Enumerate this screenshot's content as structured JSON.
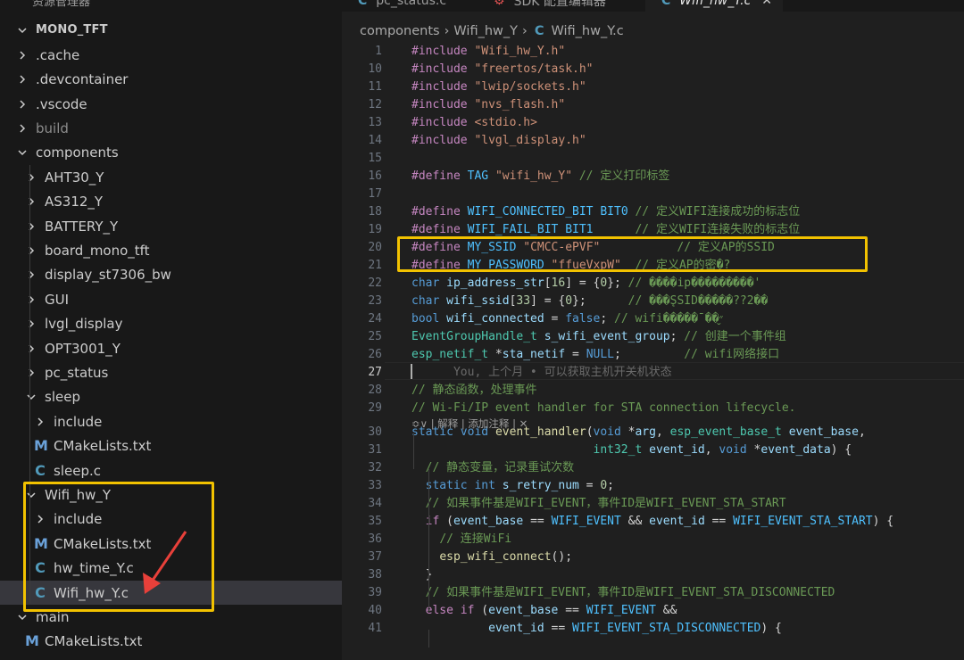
{
  "explorer": {
    "title": "资源管理器",
    "root": "MONO_TFT",
    "items": [
      {
        "label": ".cache",
        "icon": "chevron-right-icon"
      },
      {
        "label": ".devcontainer",
        "icon": "chevron-right-icon"
      },
      {
        "label": ".vscode",
        "icon": "chevron-right-icon"
      },
      {
        "label": "build",
        "icon": "chevron-right-icon"
      },
      {
        "label": "components",
        "icon": "chevron-down-icon"
      },
      {
        "label": "AHT30_Y",
        "icon": "chevron-right-icon"
      },
      {
        "label": "AS312_Y",
        "icon": "chevron-right-icon"
      },
      {
        "label": "BATTERY_Y",
        "icon": "chevron-right-icon"
      },
      {
        "label": "board_mono_tft",
        "icon": "chevron-right-icon"
      },
      {
        "label": "display_st7306_bw",
        "icon": "chevron-right-icon"
      },
      {
        "label": "GUI",
        "icon": "chevron-right-icon"
      },
      {
        "label": "lvgl_display",
        "icon": "chevron-right-icon"
      },
      {
        "label": "OPT3001_Y",
        "icon": "chevron-right-icon"
      },
      {
        "label": "pc_status",
        "icon": "chevron-right-icon"
      },
      {
        "label": "sleep",
        "icon": "chevron-down-icon"
      },
      {
        "label": "include",
        "icon": "chevron-right-icon"
      },
      {
        "label": "CMakeLists.txt",
        "icon": "cmake-file-icon",
        "glyph": "M"
      },
      {
        "label": "sleep.c",
        "icon": "c-file-icon",
        "glyph": "C"
      },
      {
        "label": "Wifi_hw_Y",
        "icon": "chevron-down-icon"
      },
      {
        "label": "include",
        "icon": "chevron-right-icon"
      },
      {
        "label": "CMakeLists.txt",
        "icon": "cmake-file-icon",
        "glyph": "M"
      },
      {
        "label": "hw_time_Y.c",
        "icon": "c-file-icon",
        "glyph": "C"
      },
      {
        "label": "Wifi_hw_Y.c",
        "icon": "c-file-icon",
        "glyph": "C"
      },
      {
        "label": "main",
        "icon": "chevron-down-icon"
      },
      {
        "label": "CMakeLists.txt",
        "icon": "cmake-file-icon",
        "glyph": "M"
      }
    ]
  },
  "tabs": [
    {
      "label": "pc_status.c",
      "glyph": "C",
      "active": false
    },
    {
      "label": "SDK 配置编辑器",
      "glyph": "⚙",
      "active": false
    },
    {
      "label": "Wifi_hw_Y.c",
      "glyph": "C",
      "active": true,
      "close": "✕"
    }
  ],
  "breadcrumb": {
    "part1": "components",
    "sep": "›",
    "part2": "Wifi_hw_Y",
    "file_glyph": "C",
    "part3": "Wifi_hw_Y.c"
  },
  "codelens": "≎∨ | 解释 | 添加注释 | ✕",
  "code_lines": [
    {
      "n": "1",
      "t": [
        [
          "pp",
          "#include "
        ],
        [
          "str",
          "\"Wifi_hw_Y.h\""
        ]
      ]
    },
    {
      "n": "10",
      "t": [
        [
          "pp",
          "#include "
        ],
        [
          "str",
          "\"freertos/task.h\""
        ]
      ]
    },
    {
      "n": "11",
      "t": [
        [
          "pp",
          "#include "
        ],
        [
          "str",
          "\"lwip/sockets.h\""
        ]
      ]
    },
    {
      "n": "12",
      "t": [
        [
          "pp",
          "#include "
        ],
        [
          "str",
          "\"nvs_flash.h\""
        ]
      ]
    },
    {
      "n": "13",
      "t": [
        [
          "pp",
          "#include "
        ],
        [
          "str",
          "<stdio.h>"
        ]
      ]
    },
    {
      "n": "14",
      "t": [
        [
          "pp",
          "#include "
        ],
        [
          "str",
          "\"lvgl_display.h\""
        ]
      ]
    },
    {
      "n": "15",
      "t": []
    },
    {
      "n": "16",
      "t": [
        [
          "pp",
          "#define "
        ],
        [
          "mac",
          "TAG "
        ],
        [
          "str",
          "\"wifi_hw_Y\""
        ],
        [
          "cm",
          " // 定义打印标签"
        ]
      ]
    },
    {
      "n": "17",
      "t": []
    },
    {
      "n": "18",
      "t": [
        [
          "pp",
          "#define "
        ],
        [
          "mac",
          "WIFI_CONNECTED_BIT "
        ],
        [
          "mac",
          "BIT0"
        ],
        [
          "cm",
          " // 定义WIFI连接成功的标志位"
        ]
      ]
    },
    {
      "n": "19",
      "t": [
        [
          "pp",
          "#define "
        ],
        [
          "mac",
          "WIFI_FAIL_BIT "
        ],
        [
          "mac",
          "BIT1"
        ],
        [
          "cm",
          "      // 定义WIFI连接失败的标志位"
        ]
      ]
    },
    {
      "n": "20",
      "t": [
        [
          "pp",
          "#define "
        ],
        [
          "mac",
          "MY_SSID "
        ],
        [
          "str",
          "\"CMCC-ePVF\""
        ],
        [
          "cm",
          "           // 定义AP的SSID"
        ]
      ]
    },
    {
      "n": "21",
      "t": [
        [
          "pp",
          "#define "
        ],
        [
          "mac",
          "MY_PASSWORD "
        ],
        [
          "str",
          "\"ffueVxpW\""
        ],
        [
          "cm",
          "  // 定义AP的密�?"
        ]
      ]
    },
    {
      "n": "22",
      "t": [
        [
          "kw",
          "char "
        ],
        [
          "var",
          "ip_address_str"
        ],
        [
          "tx",
          "["
        ],
        [
          "num",
          "16"
        ],
        [
          "tx",
          "] = {"
        ],
        [
          "num",
          "0"
        ],
        [
          "tx",
          "}; "
        ],
        [
          "cm",
          "// ����ip���������'"
        ]
      ]
    },
    {
      "n": "23",
      "t": [
        [
          "kw",
          "char "
        ],
        [
          "var",
          "wifi_ssid"
        ],
        [
          "tx",
          "["
        ],
        [
          "num",
          "33"
        ],
        [
          "tx",
          "] = {"
        ],
        [
          "num",
          "0"
        ],
        [
          "tx",
          "};      "
        ],
        [
          "cm",
          "// ���̨SSID�����??2��"
        ]
      ]
    },
    {
      "n": "24",
      "t": [
        [
          "kw",
          "bool "
        ],
        [
          "var",
          "wifi_connected"
        ],
        [
          "tx",
          " = "
        ],
        [
          "kw",
          "false"
        ],
        [
          "tx",
          "; "
        ],
        [
          "cm",
          "// wifi�����ˉ��״̬"
        ]
      ]
    },
    {
      "n": "25",
      "t": [
        [
          "ty",
          "EventGroupHandle_t "
        ],
        [
          "var",
          "s_wifi_event_group"
        ],
        [
          "tx",
          "; "
        ],
        [
          "cm",
          "// 创建一个事件组"
        ]
      ]
    },
    {
      "n": "26",
      "t": [
        [
          "ty",
          "esp_netif_t "
        ],
        [
          "tx",
          "*"
        ],
        [
          "var",
          "sta_netif"
        ],
        [
          "tx",
          " = "
        ],
        [
          "kw",
          "NULL"
        ],
        [
          "tx",
          ";         "
        ],
        [
          "cm",
          "// wifi网络接口"
        ]
      ]
    },
    {
      "n": "27",
      "t": [
        [
          "gh",
          "      You, 上个月 • 可以获取主机开关机状态"
        ]
      ]
    },
    {
      "n": "28",
      "t": [
        [
          "cm",
          "// 静态函数，处理事件"
        ]
      ]
    },
    {
      "n": "29",
      "t": [
        [
          "cm",
          "// Wi-Fi/IP event handler for STA connection lifecycle."
        ]
      ]
    },
    {
      "n": "30",
      "t": [
        [
          "kw",
          "static "
        ],
        [
          "kw",
          "void "
        ],
        [
          "fn",
          "event_handler"
        ],
        [
          "tx",
          "("
        ],
        [
          "kw",
          "void "
        ],
        [
          "tx",
          "*"
        ],
        [
          "var",
          "arg"
        ],
        [
          "tx",
          ", "
        ],
        [
          "ty",
          "esp_event_base_t "
        ],
        [
          "var",
          "event_base"
        ],
        [
          "tx",
          ","
        ]
      ]
    },
    {
      "n": "31",
      "t": [
        [
          "tx",
          "                          "
        ],
        [
          "ty",
          "int32_t "
        ],
        [
          "var",
          "event_id"
        ],
        [
          "tx",
          ", "
        ],
        [
          "kw",
          "void "
        ],
        [
          "tx",
          "*"
        ],
        [
          "var",
          "event_data"
        ],
        [
          "tx",
          ") {"
        ]
      ]
    },
    {
      "n": "32",
      "t": [
        [
          "tx",
          "  "
        ],
        [
          "cm",
          "// 静态变量，记录重试次数"
        ]
      ]
    },
    {
      "n": "33",
      "t": [
        [
          "tx",
          "  "
        ],
        [
          "kw",
          "static "
        ],
        [
          "kw",
          "int "
        ],
        [
          "var",
          "s_retry_num"
        ],
        [
          "tx",
          " = "
        ],
        [
          "num",
          "0"
        ],
        [
          "tx",
          ";"
        ]
      ]
    },
    {
      "n": "34",
      "t": [
        [
          "tx",
          "  "
        ],
        [
          "cm",
          "// 如果事件基是WIFI_EVENT，事件ID是WIFI_EVENT_STA_START"
        ]
      ]
    },
    {
      "n": "35",
      "t": [
        [
          "tx",
          "  "
        ],
        [
          "pp",
          "if "
        ],
        [
          "tx",
          "("
        ],
        [
          "var",
          "event_base"
        ],
        [
          "tx",
          " == "
        ],
        [
          "mac",
          "WIFI_EVENT"
        ],
        [
          "tx",
          " && "
        ],
        [
          "var",
          "event_id"
        ],
        [
          "tx",
          " == "
        ],
        [
          "mac",
          "WIFI_EVENT_STA_START"
        ],
        [
          "tx",
          ") {"
        ]
      ]
    },
    {
      "n": "36",
      "t": [
        [
          "tx",
          "    "
        ],
        [
          "cm",
          "// 连接WiFi"
        ]
      ]
    },
    {
      "n": "37",
      "t": [
        [
          "tx",
          "    "
        ],
        [
          "fn",
          "esp_wifi_connect"
        ],
        [
          "tx",
          "();"
        ]
      ]
    },
    {
      "n": "38",
      "t": [
        [
          "tx",
          "  }"
        ]
      ]
    },
    {
      "n": "39",
      "t": [
        [
          "tx",
          "  "
        ],
        [
          "cm",
          "// 如果事件基是WIFI_EVENT，事件ID是WIFI_EVENT_STA_DISCONNECTED"
        ]
      ]
    },
    {
      "n": "40",
      "t": [
        [
          "tx",
          "  "
        ],
        [
          "pp",
          "else if "
        ],
        [
          "tx",
          "("
        ],
        [
          "var",
          "event_base"
        ],
        [
          "tx",
          " == "
        ],
        [
          "mac",
          "WIFI_EVENT"
        ],
        [
          "tx",
          " &&"
        ]
      ]
    },
    {
      "n": "41",
      "t": [
        [
          "tx",
          "           "
        ],
        [
          "var",
          "event_id"
        ],
        [
          "tx",
          " == "
        ],
        [
          "mac",
          "WIFI_EVENT_STA_DISCONNECTED"
        ],
        [
          "tx",
          ") {"
        ]
      ]
    }
  ]
}
